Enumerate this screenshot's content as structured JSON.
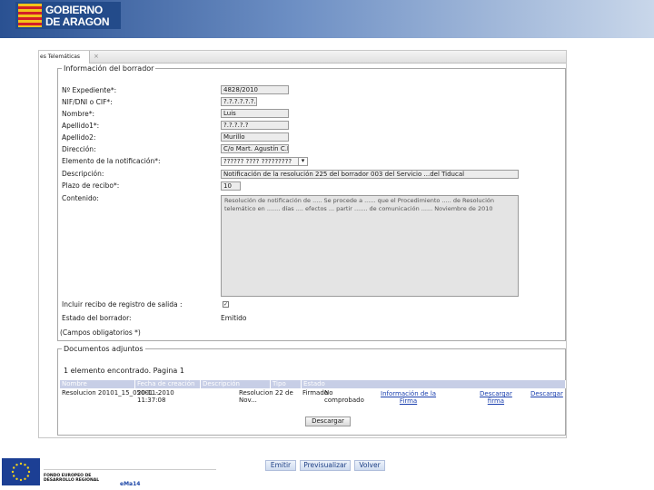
{
  "header": {
    "logo_line1": "GOBIERNO",
    "logo_line2": "DE ARAGON"
  },
  "tabs": {
    "active_label": "es Telemáticas",
    "close_glyph": "×"
  },
  "info": {
    "legend": "Información del borrador",
    "fields": [
      {
        "label": "Nº Expediente*:",
        "value": "4828/2010"
      },
      {
        "label": "NIF/DNI o CIF*:",
        "value": "?.?.?.?.?.?.?.?"
      },
      {
        "label": "Nombre*:",
        "value": "Luis"
      },
      {
        "label": "Apellido1*:",
        "value": "?.?.?.?.?"
      },
      {
        "label": "Apellido2:",
        "value": "Murillo"
      },
      {
        "label": "Dirección:",
        "value": "C/o Mart. Agustín C.B"
      },
      {
        "label": "Elemento de la notificación*:",
        "value": "?????? ???? ?????????"
      },
      {
        "label": "Descripción:",
        "value": "Notificación de la resolución 225 del borrador 003 del Servicio ...del Tiducal"
      },
      {
        "label": "Plazo de recibo*:",
        "value": "10"
      },
      {
        "label": "Contenido:",
        "value": "Resolución de notificación de ..... Se procede a ...... que el Procedimiento ..... de Resolución telemático en ....... días .... efectos ... partir ....... de comunicación ...... Noviembre de 2010"
      }
    ],
    "recibo_label": "Incluir recibo de registro de salida :",
    "recibo_checked_glyph": "✓",
    "estado_label": "Estado del borrador:",
    "estado_value": "Emitido",
    "campos_note": "(Campos obligatorios *)"
  },
  "docs": {
    "legend": "Documentos adjuntos",
    "found_text": "1 elemento encontrado. Pagina 1",
    "columns": [
      "Nombre",
      "Fecha de creación",
      "Descripción",
      "Tipo",
      "Estado"
    ],
    "row": {
      "nombre": "Resolucion 20101_15_05001 ...",
      "fecha_line1": "20-11-2010",
      "fecha_line2": "11:37:08",
      "descripcion_line1": "Resolucion 22 de",
      "descripcion_line2": "Nov...",
      "tipo": "Firmado",
      "estado_line1": "No",
      "estado_line2": "comprobado",
      "link_info_line1": "Información de la",
      "link_info_line2": "Firma",
      "link_desc_firma_line1": "Descargar",
      "link_desc_firma_line2": "firma",
      "link_descargar": "Descargar"
    },
    "download_button": "Descargar"
  },
  "actions": {
    "emitir": "Emitir",
    "previsualizar": "Previsualizar",
    "volver": "Volver"
  },
  "footer": {
    "eu_line1": "FONDO EUROPEO DE",
    "eu_line2": "DESARROLLO REGIONAL",
    "link_text": "eMa14"
  },
  "colors": {
    "banner": "#2a5192",
    "table_header": "#c7cee6",
    "link": "#1a3fae"
  }
}
